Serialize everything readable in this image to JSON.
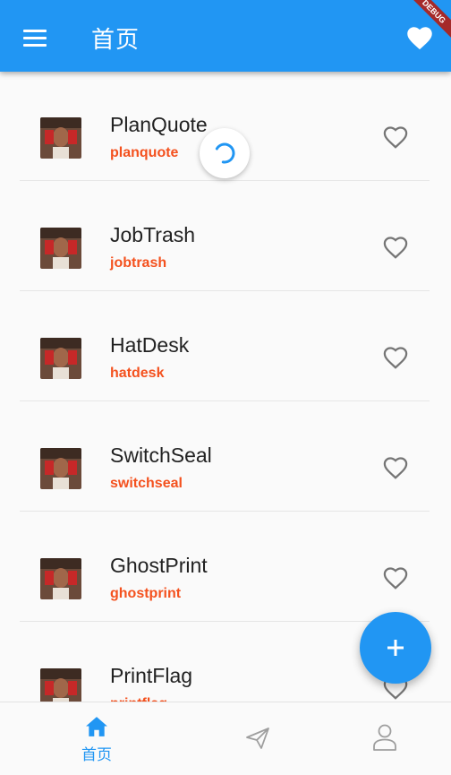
{
  "appbar": {
    "title": "首页",
    "menu_icon": "menu-icon",
    "favorite_icon": "heart-filled-icon",
    "debug_banner": "DEBUG",
    "color": "#2196f3"
  },
  "list": {
    "items": [
      {
        "name": "PlanQuote",
        "code": "planquote"
      },
      {
        "name": "JobTrash",
        "code": "jobtrash"
      },
      {
        "name": "HatDesk",
        "code": "hatdesk"
      },
      {
        "name": "SwitchSeal",
        "code": "switchseal"
      },
      {
        "name": "GhostPrint",
        "code": "ghostprint"
      },
      {
        "name": "PrintFlag",
        "code": "printflag"
      }
    ],
    "code_color": "#f4511e"
  },
  "fab": {
    "icon": "plus-icon"
  },
  "bottom_nav": {
    "items": [
      {
        "label": "首页",
        "icon": "home-icon",
        "active": true
      },
      {
        "label": "",
        "icon": "send-icon",
        "active": false
      },
      {
        "label": "",
        "icon": "person-icon",
        "active": false
      }
    ]
  }
}
